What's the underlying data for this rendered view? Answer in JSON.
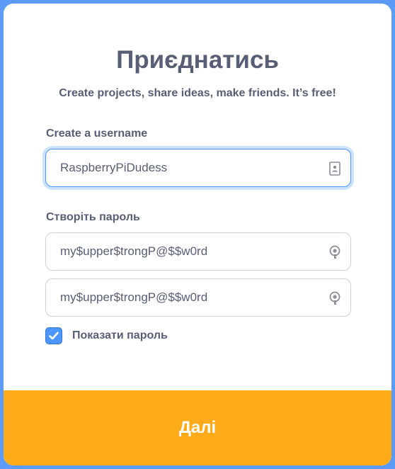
{
  "header": {
    "title": "Приєднатись",
    "subtitle": "Create projects, share ideas, make friends. It’s free!"
  },
  "username": {
    "label": "Create a username",
    "value": "RaspberryPiDudess",
    "icon": "contact-card-icon"
  },
  "password": {
    "label": "Створіть пароль",
    "value": "my$upper$trongP@$$w0rd",
    "confirm_value": "my$upper$trongP@$$w0rd",
    "icon": "password-key-icon"
  },
  "show_password": {
    "label": "Показати пароль",
    "checked": true
  },
  "footer": {
    "next_label": "Далі"
  },
  "colors": {
    "frame": "#5c9bf7",
    "text": "#575e75",
    "accent": "#4c97ff",
    "button": "#ffab19"
  }
}
